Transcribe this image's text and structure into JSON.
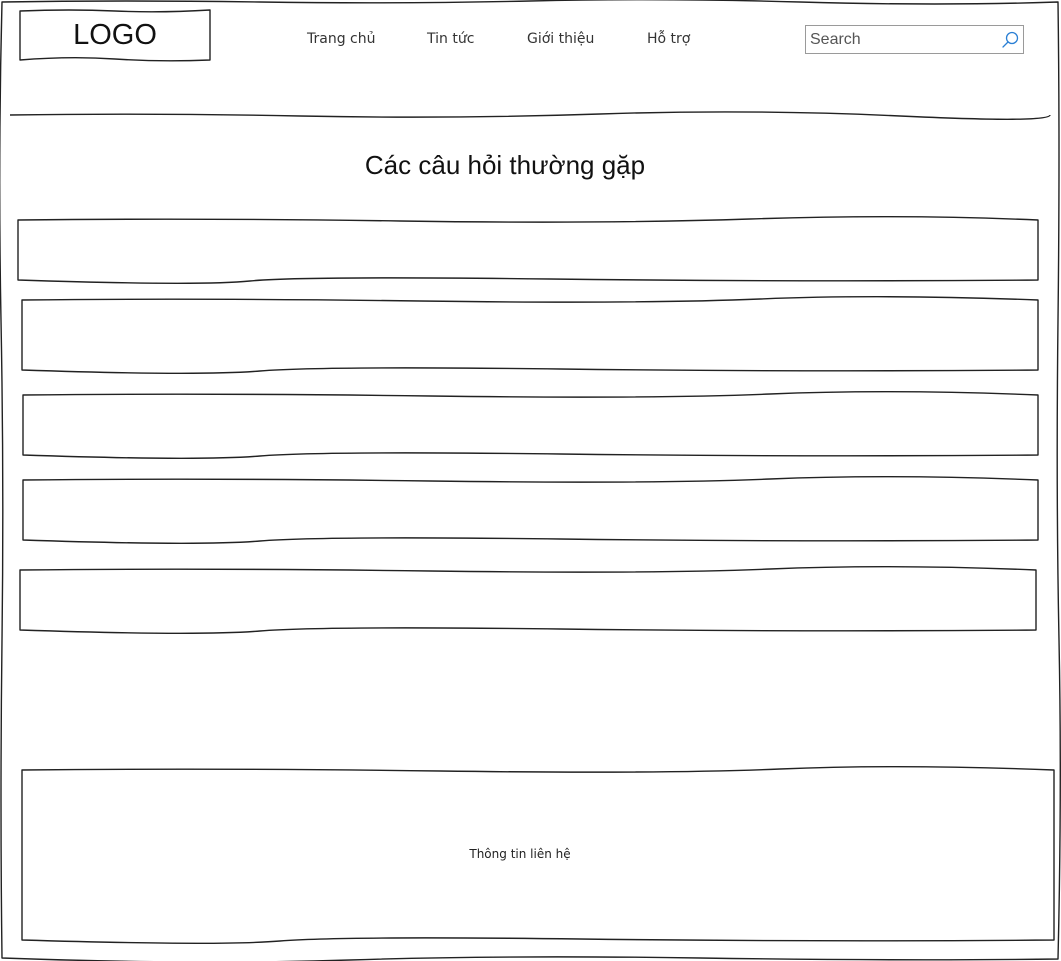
{
  "header": {
    "logo_text": "LOGO",
    "nav": [
      {
        "label": "Trang chủ"
      },
      {
        "label": "Tin tức"
      },
      {
        "label": "Giới thiệu"
      },
      {
        "label": "Hỗ trợ"
      }
    ],
    "search": {
      "placeholder": "Search",
      "value": ""
    }
  },
  "main": {
    "title": "Các câu hỏi thường gặp",
    "faq_item_count": 5
  },
  "footer": {
    "contact_label": "Thông tin liên hệ"
  },
  "colors": {
    "stroke": "#222222",
    "search_icon": "#2a7fd4",
    "background": "#ffffff"
  }
}
